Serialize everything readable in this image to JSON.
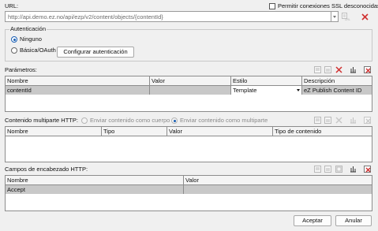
{
  "url": {
    "label": "URL:",
    "value": "http://api.demo.ez.no/api/ezp/v2/content/objects/{contentId}",
    "ssl_label": "Permitir conexiones SSL desconocidas",
    "ssl_checked": false
  },
  "auth": {
    "legend": "Autenticación",
    "option_none": "Ninguno",
    "option_basic": "Básica/OAuth",
    "selected": "Ninguno",
    "configure_label": "Configurar autenticación"
  },
  "params": {
    "label": "Parámetros:",
    "columns": [
      "Nombre",
      "Valor",
      "Estilo",
      "Descripción"
    ],
    "rows": [
      {
        "name": "contentId",
        "value": "",
        "style": "Template",
        "description": "eZ Publish Content ID"
      }
    ]
  },
  "multipart": {
    "label": "Contenido multiparte HTTP:",
    "option_body": "Enviar contenido como cuerpo",
    "option_multipart": "Enviar contenido como multiparte",
    "columns": [
      "Nombre",
      "Tipo",
      "Valor",
      "Tipo de contenido"
    ]
  },
  "headers": {
    "label": "Campos de encabezado HTTP:",
    "columns": [
      "Nombre",
      "Valor"
    ],
    "rows": [
      {
        "name": "Accept",
        "value": ""
      }
    ]
  },
  "footer": {
    "accept_label": "Aceptar",
    "cancel_label": "Anular"
  },
  "colors": {
    "delete_red": "#d03030",
    "radio_blue": "#1a5fb4",
    "selected_row": "#c8c8c8"
  }
}
